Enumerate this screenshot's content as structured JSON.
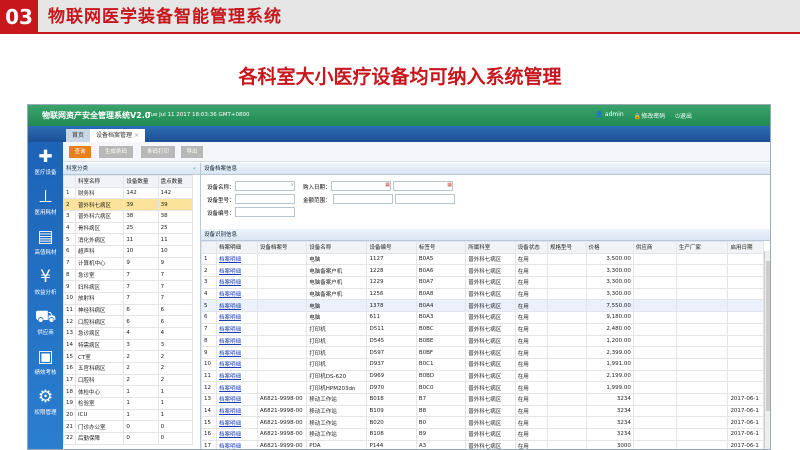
{
  "slide": {
    "number": "03",
    "title": "物联网医学装备智能管理系统",
    "subtitle": "各科室大小医疗设备均可纳入系统管理"
  },
  "app": {
    "title": "物联网资产安全管理系统V2.0",
    "datetime": "Tue Jul 11 2017 18:03:36 GMT+0800",
    "user": "admin",
    "change_password": "修改密码",
    "logout": "退出",
    "tabs": [
      "首页",
      "设备档案管理"
    ],
    "sidebar": [
      {
        "label": "医疗设备",
        "icon": "medical-kit-icon"
      },
      {
        "label": "医用耗材",
        "icon": "syringe-icon"
      },
      {
        "label": "高值耗材",
        "icon": "battery-gear-icon"
      },
      {
        "label": "效益分析",
        "icon": "yen-icon"
      },
      {
        "label": "供应商",
        "icon": "truck-icon"
      },
      {
        "label": "绩效考核",
        "icon": "id-card-icon"
      },
      {
        "label": "权限管理",
        "icon": "gear-icon"
      }
    ],
    "toolbar": [
      "查询",
      "生成条码",
      "条码打印",
      "导出"
    ],
    "left_panel": {
      "title": "科室分类",
      "columns": [
        "科室名称",
        "设备数量",
        "盘点数量"
      ],
      "rows": [
        [
          "财务科",
          "142",
          "142"
        ],
        [
          "普外科七病区",
          "39",
          "39"
        ],
        [
          "普外科六病区",
          "38",
          "38"
        ],
        [
          "骨科病区",
          "25",
          "25"
        ],
        [
          "消化外病区",
          "11",
          "11"
        ],
        [
          "超声科",
          "10",
          "10"
        ],
        [
          "计算机中心",
          "9",
          "9"
        ],
        [
          "急诊室",
          "7",
          "7"
        ],
        [
          "妇科病区",
          "7",
          "7"
        ],
        [
          "放射科",
          "7",
          "7"
        ],
        [
          "神经科病区",
          "6",
          "6"
        ],
        [
          "口腔科病区",
          "6",
          "6"
        ],
        [
          "急诊病区",
          "4",
          "4"
        ],
        [
          "特需病区",
          "3",
          "3"
        ],
        [
          "CT室",
          "2",
          "2"
        ],
        [
          "五官科病区",
          "2",
          "2"
        ],
        [
          "口腔科",
          "2",
          "2"
        ],
        [
          "体检中心",
          "1",
          "1"
        ],
        [
          "检验室",
          "1",
          "1"
        ],
        [
          "ICU",
          "1",
          "1"
        ],
        [
          "门诊办公室",
          "0",
          "0"
        ],
        [
          "后勤保障",
          "0",
          "0"
        ]
      ]
    },
    "search": {
      "title": "设备档案信息",
      "name_label": "设备名称：",
      "date_label": "购入日期：",
      "model_label": "设备型号：",
      "amount_label": "金额范围：",
      "code_label": "设备编号："
    },
    "grid": {
      "title": "设备识别信息",
      "columns": [
        "档案明细",
        "设备档案号",
        "设备名称",
        "设备编号",
        "标签号",
        "所属科室",
        "设备状态",
        "规格型号",
        "价格",
        "供应商",
        "生产厂家",
        "启用日期"
      ],
      "link": "档案明细",
      "rows": [
        [
          "",
          "电脑",
          "1127",
          "B0A5",
          "普外科七病区",
          "在用",
          "",
          "3,500.00",
          "",
          "",
          ""
        ],
        [
          "",
          "电脑备案户机",
          "1228",
          "B0A6",
          "普外科七病区",
          "在用",
          "",
          "3,300.00",
          "",
          "",
          ""
        ],
        [
          "",
          "电脑备案户机",
          "1229",
          "B0A7",
          "普外科七病区",
          "在用",
          "",
          "3,300.00",
          "",
          "",
          ""
        ],
        [
          "",
          "电脑备案户机",
          "1256",
          "B0A8",
          "普外科七病区",
          "在用",
          "",
          "3,300.00",
          "",
          "",
          ""
        ],
        [
          "",
          "电脑",
          "1378",
          "B0A4",
          "普外科七病区",
          "在用",
          "",
          "7,550.00",
          "",
          "",
          ""
        ],
        [
          "",
          "电脑",
          "611",
          "B0A3",
          "普外科七病区",
          "在用",
          "",
          "9,180.00",
          "",
          "",
          ""
        ],
        [
          "",
          "打印机",
          "D511",
          "B0BC",
          "普外科七病区",
          "在用",
          "",
          "2,480.00",
          "",
          "",
          ""
        ],
        [
          "",
          "打印机",
          "D545",
          "B0BE",
          "普外科七病区",
          "在用",
          "",
          "1,200.00",
          "",
          "",
          ""
        ],
        [
          "",
          "打印机",
          "D597",
          "B0BF",
          "普外科七病区",
          "在用",
          "",
          "2,399.00",
          "",
          "",
          ""
        ],
        [
          "",
          "打印机",
          "D937",
          "B0C1",
          "普外科七病区",
          "在用",
          "",
          "1,991.00",
          "",
          "",
          ""
        ],
        [
          "",
          "打印机DS-620",
          "D969",
          "B0BD",
          "普外科七病区",
          "在用",
          "",
          "2,199.00",
          "",
          "",
          ""
        ],
        [
          "",
          "打印机HPM203dn",
          "D970",
          "B0C0",
          "普外科七病区",
          "在用",
          "",
          "1,999.00",
          "",
          "",
          ""
        ],
        [
          "A6821-9998-00",
          "移动工作站",
          "B018",
          "B7",
          "普外科七病区",
          "在用",
          "",
          "3234",
          "",
          "",
          "2017-06-1"
        ],
        [
          "A6821-9998-00",
          "移动工作站",
          "B109",
          "B8",
          "普外科七病区",
          "在用",
          "",
          "3234",
          "",
          "",
          "2017-06-1"
        ],
        [
          "A6821-9998-00",
          "移动工作站",
          "B020",
          "B0",
          "普外科七病区",
          "在用",
          "",
          "3234",
          "",
          "",
          "2017-06-1"
        ],
        [
          "A6821-9998-00",
          "移动工作站",
          "B108",
          "B9",
          "普外科七病区",
          "在用",
          "",
          "3234",
          "",
          "",
          "2017-06-1"
        ],
        [
          "A6821-9999-00",
          "PDA",
          "P144",
          "A3",
          "普外科七病区",
          "在用",
          "",
          "3000",
          "",
          "",
          "2017-06-1"
        ],
        [
          "A6821-9999-00",
          "PDA",
          "P181",
          "90",
          "普外科七病区",
          "在用",
          "",
          "3000",
          "",
          "",
          "2017-06-1"
        ]
      ]
    }
  },
  "colors": {
    "accent": "#c8161d",
    "primary_button": "#e8801e",
    "selected_row": "#fbe39a"
  }
}
